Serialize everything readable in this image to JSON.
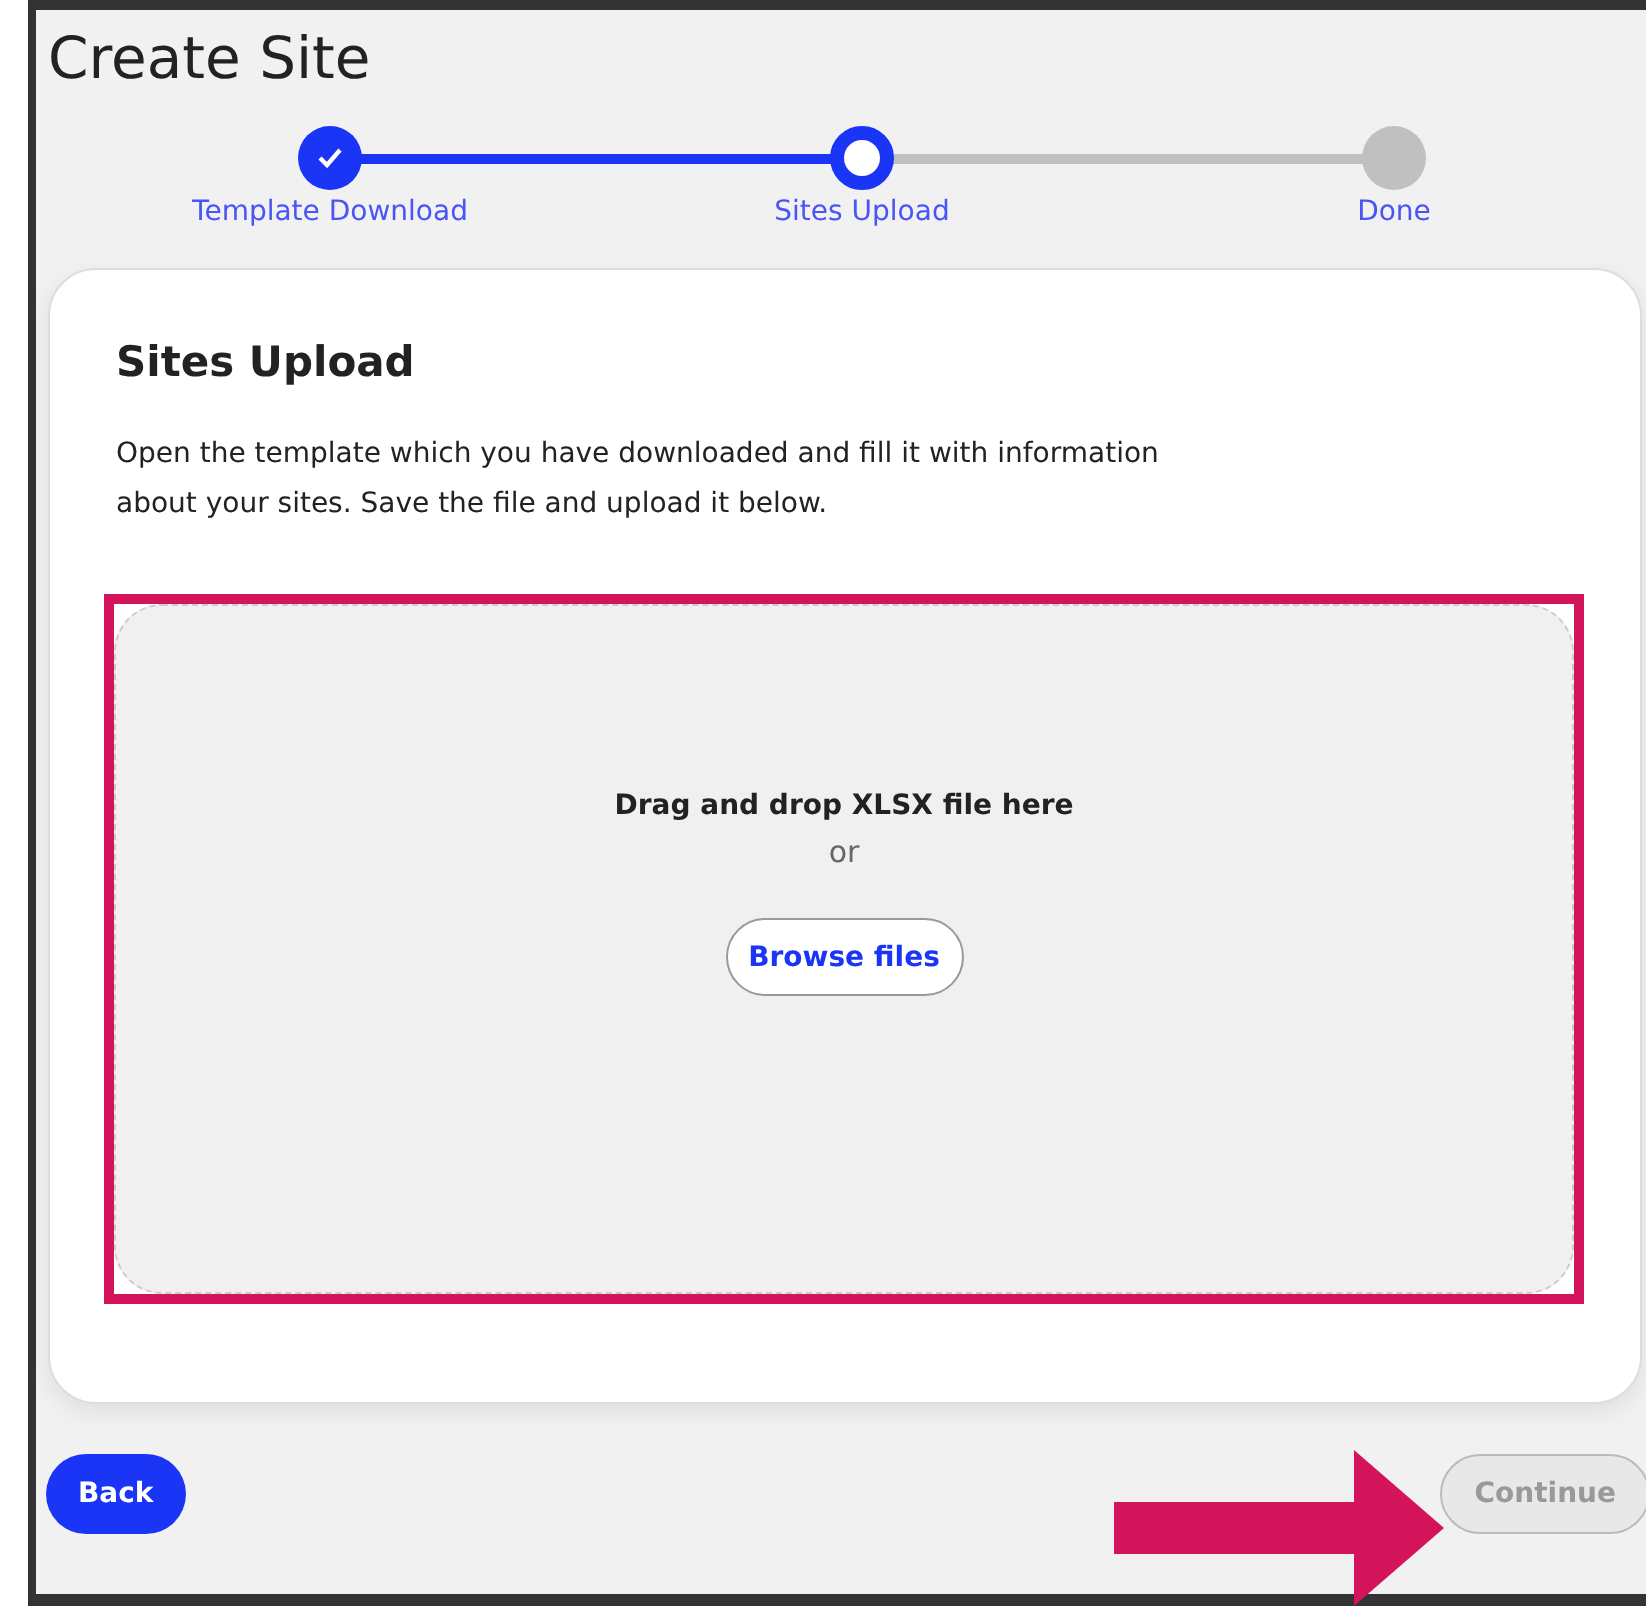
{
  "title": "Create Site",
  "steps": [
    {
      "label": "Template Download",
      "completed": true,
      "selected": false
    },
    {
      "label": "Sites Upload",
      "completed": false,
      "selected": true
    },
    {
      "label": "Done",
      "completed": false,
      "selected": false
    }
  ],
  "card": {
    "heading": "Sites Upload",
    "text": "Open the template which you have downloaded and fill it with information about your sites. Save the file and upload it below.",
    "dropzone": {
      "prompt": "Drag and drop XLSX file here",
      "or": "or",
      "button": "Browse files"
    }
  },
  "buttons": {
    "back": {
      "label": "Back",
      "disabled": false
    },
    "continue": {
      "label": "Continue",
      "disabled": true
    }
  },
  "annotations": {
    "highlight": {
      "color": "#d4145a"
    },
    "arrow": {
      "color": "#d4145a"
    }
  }
}
